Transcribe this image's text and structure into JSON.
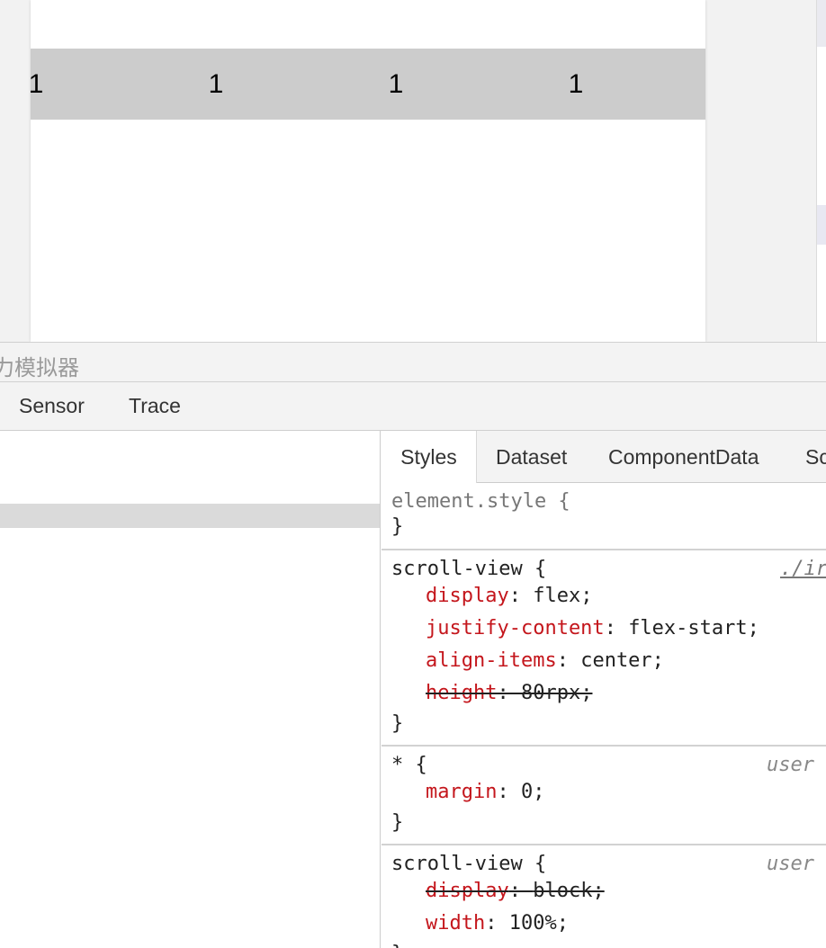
{
  "simulator": {
    "scroll_items": [
      "1",
      "1",
      "1",
      "1"
    ]
  },
  "devtools": {
    "title_partial": "力模拟器",
    "panel_tabs": [
      "Sensor",
      "Trace"
    ],
    "sub_tabs": [
      "Styles",
      "Dataset",
      "ComponentData",
      "Sc"
    ],
    "active_sub_tab": "Styles"
  },
  "styles": {
    "element_style": {
      "selector": "element.style {",
      "close": "}"
    },
    "rule1": {
      "selector": "scroll-view {",
      "source": "./ir",
      "decls": [
        {
          "prop": "display",
          "value": "flex;"
        },
        {
          "prop": "justify-content",
          "value": "flex-start;"
        },
        {
          "prop": "align-items",
          "value": "center;"
        },
        {
          "prop": "height",
          "value": "80rpx;",
          "overridden": true
        }
      ],
      "close": "}"
    },
    "rule2": {
      "selector": "* {",
      "origin": "user",
      "decls": [
        {
          "prop": "margin",
          "value": "0;"
        }
      ],
      "close": "}"
    },
    "rule3": {
      "selector": "scroll-view {",
      "origin": "user",
      "decls": [
        {
          "prop": "display",
          "value": "block;",
          "overridden": true
        },
        {
          "prop": "width",
          "value": "100%;"
        }
      ],
      "close": "}"
    }
  },
  "colors": {
    "property_name": "#c4161c",
    "selected_row": "#cccccc"
  }
}
